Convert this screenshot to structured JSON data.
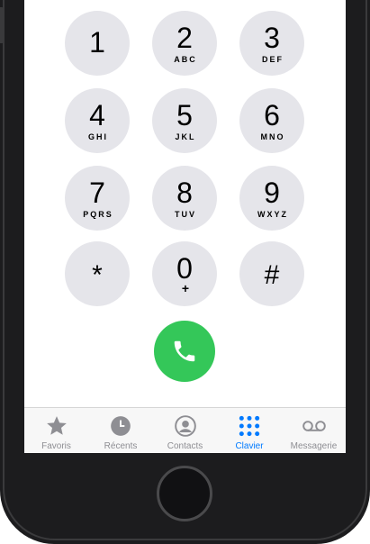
{
  "keypad": {
    "keys": [
      {
        "digit": "1",
        "letters": ""
      },
      {
        "digit": "2",
        "letters": "ABC"
      },
      {
        "digit": "3",
        "letters": "DEF"
      },
      {
        "digit": "4",
        "letters": "GHI"
      },
      {
        "digit": "5",
        "letters": "JKL"
      },
      {
        "digit": "6",
        "letters": "MNO"
      },
      {
        "digit": "7",
        "letters": "PQRS"
      },
      {
        "digit": "8",
        "letters": "TUV"
      },
      {
        "digit": "9",
        "letters": "WXYZ"
      },
      {
        "digit": "*",
        "letters": ""
      },
      {
        "digit": "0",
        "letters": "+"
      },
      {
        "digit": "#",
        "letters": ""
      }
    ]
  },
  "tabbar": {
    "tabs": [
      {
        "label": "Favoris",
        "icon": "star-icon"
      },
      {
        "label": "Récents",
        "icon": "clock-icon"
      },
      {
        "label": "Contacts",
        "icon": "contact-icon"
      },
      {
        "label": "Clavier",
        "icon": "keypad-icon"
      },
      {
        "label": "Messagerie",
        "icon": "voicemail-icon"
      }
    ],
    "active_index": 3
  },
  "colors": {
    "key_background": "#e5e5ea",
    "call_green": "#34c759",
    "active_blue": "#007aff",
    "inactive_gray": "#8e8e93"
  }
}
